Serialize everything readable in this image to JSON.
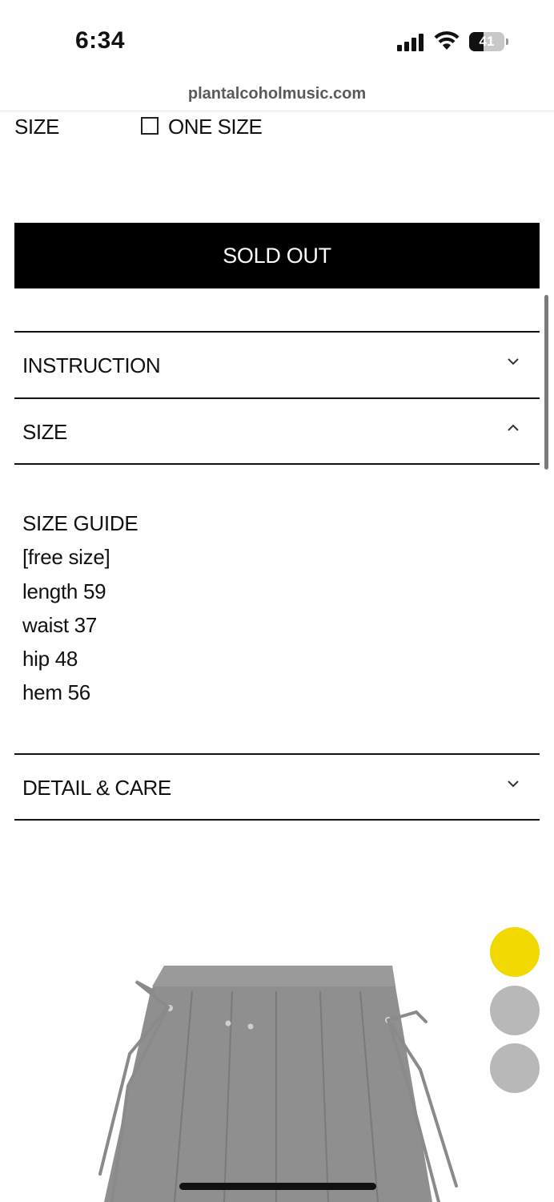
{
  "status_bar": {
    "time": "6:34",
    "battery": "41"
  },
  "browser": {
    "url": "plantalcoholmusic.com"
  },
  "option": {
    "label": "SIZE",
    "value": "ONE SIZE",
    "checked": false
  },
  "purchase": {
    "button_label": "SOLD OUT"
  },
  "accordion": {
    "instruction": {
      "title": "INSTRUCTION",
      "expanded": false
    },
    "size": {
      "title": "SIZE",
      "expanded": true,
      "lines": [
        "SIZE GUIDE",
        "[free size]",
        "length 59",
        "waist 37",
        "hip 48",
        "hem 56"
      ]
    },
    "detail_care": {
      "title": "DETAIL & CARE",
      "expanded": false
    }
  },
  "carousel": {
    "dots": [
      {
        "color": "#f1d800",
        "active": true
      },
      {
        "color": "#b8b8b8",
        "active": false
      },
      {
        "color": "#b8b8b8",
        "active": false
      }
    ]
  },
  "colors": {
    "black": "#000000",
    "accent_yellow": "#f1d800",
    "skirt_gray": "#8d8d8d"
  }
}
